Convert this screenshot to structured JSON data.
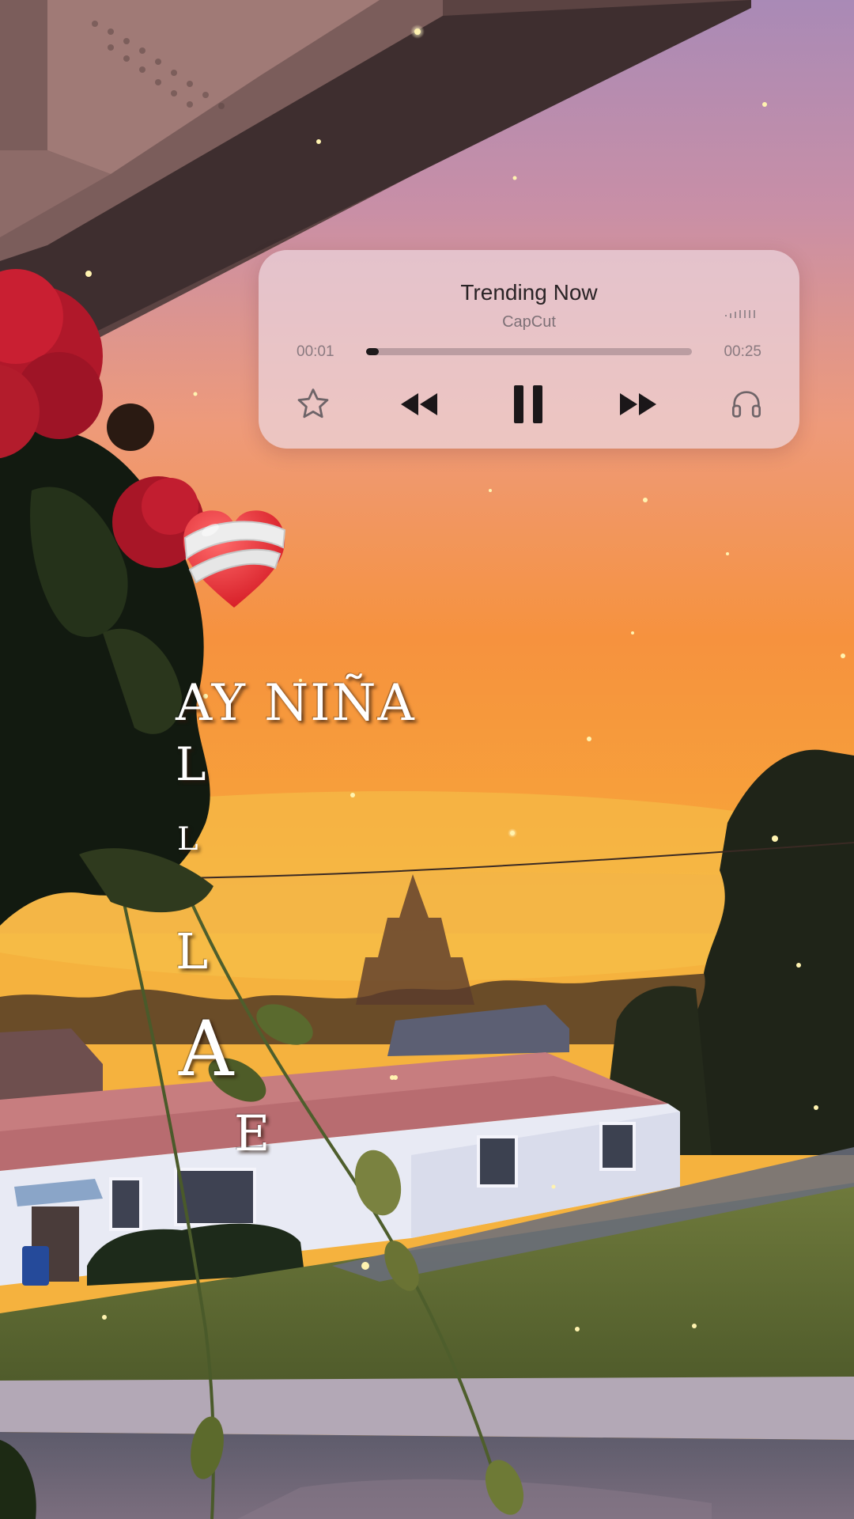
{
  "player": {
    "title": "Trending Now",
    "artist": "CapCut",
    "elapsed": "00:01",
    "duration": "00:25",
    "progress": 0.04,
    "state": "playing",
    "icons": [
      "star-icon",
      "rewind-icon",
      "pause-icon",
      "fast-forward-icon",
      "headphones-icon",
      "signal-icon"
    ]
  },
  "lyrics": {
    "line1": "AY NIÑA",
    "letters": [
      "L",
      "L",
      "L",
      "A",
      "E"
    ]
  },
  "sticker": "mending-heart-icon",
  "colors": {
    "player_bg": "#ecd6de",
    "player_text": "#2a2426",
    "sky_top": "#b98aa7",
    "sky_bottom": "#f58c2e",
    "heart": "#e8222b"
  }
}
